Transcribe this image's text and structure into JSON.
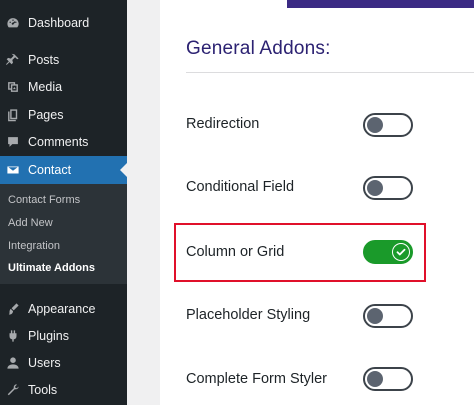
{
  "sidebar": {
    "items": [
      {
        "label": "Dashboard",
        "icon": "dashboard-icon"
      },
      {
        "label": "Posts",
        "icon": "pin-icon"
      },
      {
        "label": "Media",
        "icon": "media-icon"
      },
      {
        "label": "Pages",
        "icon": "pages-icon"
      },
      {
        "label": "Comments",
        "icon": "comment-icon"
      },
      {
        "label": "Contact",
        "icon": "envelope-icon",
        "active": true
      },
      {
        "label": "Appearance",
        "icon": "brush-icon"
      },
      {
        "label": "Plugins",
        "icon": "plugin-icon"
      },
      {
        "label": "Users",
        "icon": "user-icon"
      },
      {
        "label": "Tools",
        "icon": "wrench-icon"
      }
    ],
    "submenu": [
      "Contact Forms",
      "Add New",
      "Integration",
      "Ultimate Addons"
    ],
    "current_submenu": "Ultimate Addons"
  },
  "main": {
    "section_title": "General Addons:",
    "addons": [
      {
        "label": "Redirection",
        "enabled": false
      },
      {
        "label": "Conditional Field",
        "enabled": false
      },
      {
        "label": "Column or Grid",
        "enabled": true,
        "highlighted": true
      },
      {
        "label": "Placeholder Styling",
        "enabled": false
      },
      {
        "label": "Complete Form Styler",
        "enabled": false
      }
    ]
  },
  "colors": {
    "sidebar_bg": "#1d2327",
    "active_menu": "#2271b1",
    "title_color": "#2c2272",
    "toggle_on": "#1a9a2a",
    "highlight_border": "#e0102a"
  }
}
